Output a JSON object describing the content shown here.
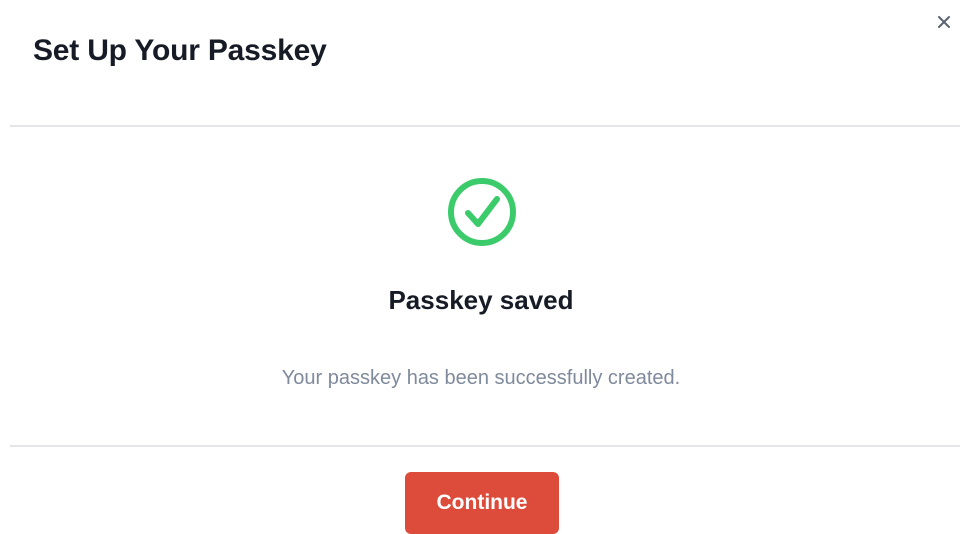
{
  "dialog": {
    "title": "Set Up Your Passkey",
    "close_icon": "close-icon"
  },
  "status": {
    "icon": "check-circle-icon",
    "icon_color": "#3ccb6a",
    "title": "Passkey saved",
    "message": "Your passkey has been successfully created."
  },
  "actions": {
    "continue_label": "Continue",
    "continue_color": "#dd4b3b"
  }
}
